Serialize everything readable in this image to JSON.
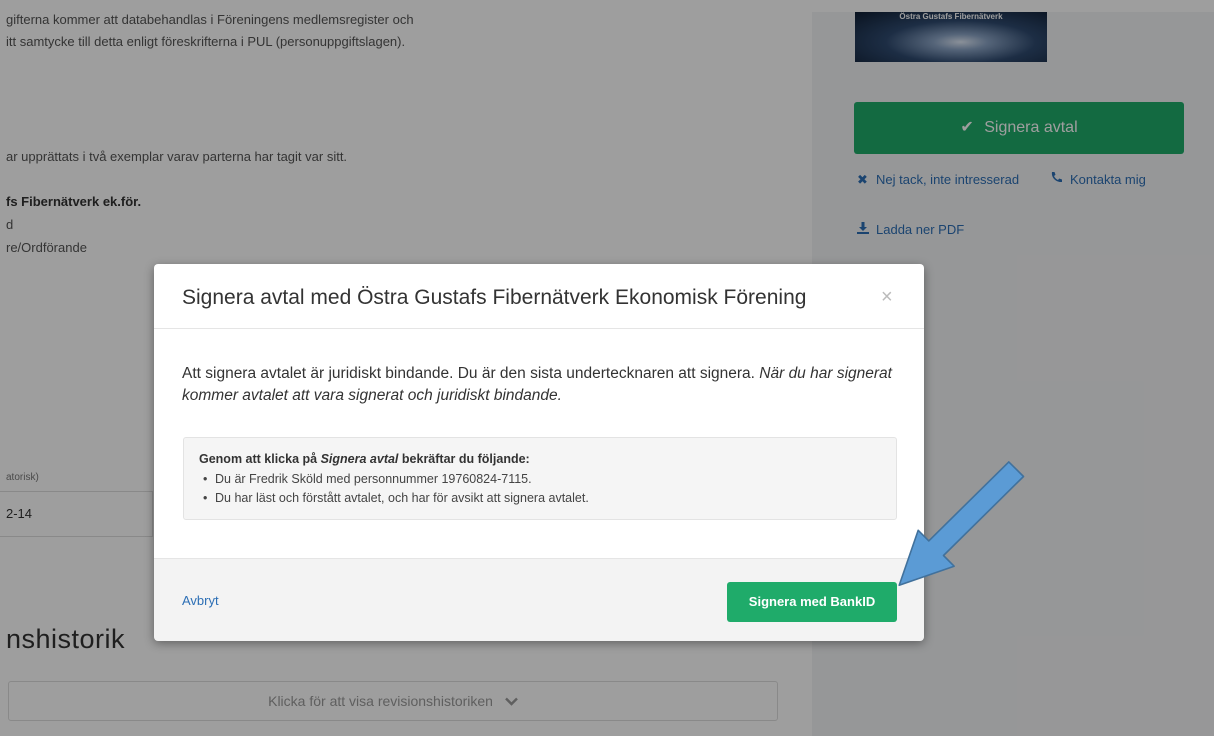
{
  "background": {
    "text_line1": "gifterna kommer att databehandlas i Föreningens medlemsregister och",
    "text_line2": "itt samtycke till detta enligt föreskrifterna i PUL (personuppgiftslagen).",
    "copies_text": "ar upprättats i två exemplar varav parterna har tagit var sitt.",
    "org_name": "fs Fibernätverk ek.för.",
    "org_line2": "d",
    "org_role": "re/Ordförande",
    "date_label": "atorisk)",
    "date_value": "2-14",
    "revision_title": "nshistorik",
    "revision_button": "Klicka för att visa revisionshistoriken"
  },
  "sidebar": {
    "logo_text": "Östra Gustafs Fibernätverk",
    "sign_button": "Signera avtal",
    "decline_link": "Nej tack, inte intresserad",
    "contact_link": "Kontakta mig",
    "download_link": "Ladda ner PDF"
  },
  "modal": {
    "title": "Signera avtal med Östra Gustafs Fibernätverk Ekonomisk Förening",
    "close_symbol": "×",
    "body_text": "Att signera avtalet är juridiskt bindande. Du är den sista undertecknaren att signera.",
    "body_italic": "När du har signerat kommer avtalet att vara signerat och juridiskt bindande.",
    "info_head_prefix": "Genom att klicka på",
    "info_head_italic": "Signera avtal",
    "info_head_suffix": "bekräftar du följande:",
    "info_items": [
      "Du är Fredrik Sköld med personnummer 19760824-7115.",
      "Du har läst och förstått avtalet, och har för avsikt att signera avtalet."
    ],
    "cancel_label": "Avbryt",
    "bankid_button": "Signera med BankID"
  },
  "colors": {
    "accent_green": "#1fab6a",
    "link_blue": "#2d6fb5",
    "arrow_fill": "#5b9bd5",
    "arrow_stroke": "#41719c"
  },
  "icons": {
    "sign_check": "checkmark-icon",
    "decline": "close-icon",
    "contact": "phone-icon",
    "download": "download-icon",
    "revision_chevron": "chevron-down-icon",
    "annotation": "arrow-pointer-icon"
  }
}
